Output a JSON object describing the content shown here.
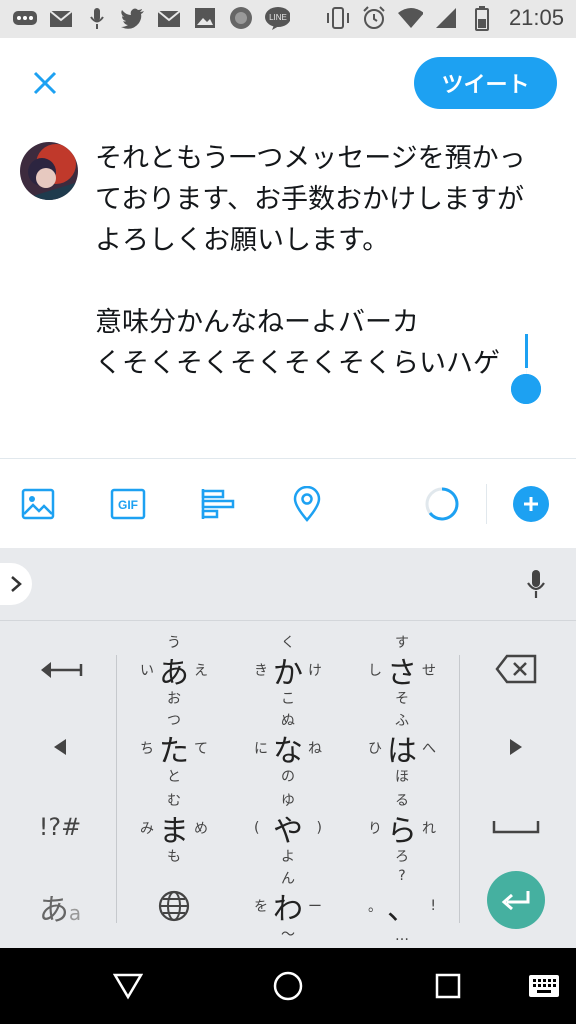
{
  "status_bar": {
    "time": "21:05",
    "left_icons": [
      "more-icon",
      "mail-icon",
      "mic-icon",
      "twitter-icon",
      "mail-icon",
      "image-icon",
      "app-badge-icon",
      "line-icon"
    ],
    "right_icons": [
      "vibrate-icon",
      "alarm-icon",
      "wifi-icon",
      "signal-icon",
      "battery-icon"
    ]
  },
  "compose": {
    "tweet_label": "ツイート",
    "text": "それともう一つメッセージを預かっ\nております、お手数おかけしますが\nよろしくお願いします。\n\n意味分かんなねーよバーカ\nくそくそくそくそくそくらいハゲ"
  },
  "toolbar": {
    "gif_label": "GIF",
    "icons": [
      "image-icon",
      "gif-icon",
      "poll-icon",
      "location-icon",
      "character-counter-icon",
      "add-icon"
    ]
  },
  "keyboard": {
    "left_keys": {
      "undo": "←",
      "left": "◀",
      "symbols": "!?#",
      "kana_main": "あ",
      "kana_sub": "a"
    },
    "right_keys": {
      "backspace": "⌫",
      "right": "▶",
      "space": "space",
      "enter": "enter"
    },
    "keys": [
      {
        "main": "あ",
        "up": "う",
        "down": "お",
        "left": "い",
        "right": "え"
      },
      {
        "main": "か",
        "up": "く",
        "down": "こ",
        "left": "き",
        "right": "け"
      },
      {
        "main": "さ",
        "up": "す",
        "down": "そ",
        "left": "し",
        "right": "せ"
      },
      {
        "main": "た",
        "up": "つ",
        "down": "と",
        "left": "ち",
        "right": "て"
      },
      {
        "main": "な",
        "up": "ぬ",
        "down": "の",
        "left": "に",
        "right": "ね"
      },
      {
        "main": "は",
        "up": "ふ",
        "down": "ほ",
        "left": "ひ",
        "right": "へ"
      },
      {
        "main": "ま",
        "up": "む",
        "down": "も",
        "left": "み",
        "right": "め"
      },
      {
        "main": "や",
        "up": "ゆ",
        "down": "よ",
        "left": "(",
        "right": ")"
      },
      {
        "main": "ら",
        "up": "る",
        "down": "ろ",
        "left": "り",
        "right": "れ"
      },
      {
        "main": "わ",
        "up": "ん",
        "down": "〜",
        "left": "を",
        "right": "ー"
      },
      {
        "main": "、",
        "up": "?",
        "down": "…",
        "left": "。",
        "right": "!"
      }
    ]
  },
  "colors": {
    "accent": "#1da1f2",
    "enter": "#45b0a0",
    "keyboard_bg": "#e8eaed"
  }
}
